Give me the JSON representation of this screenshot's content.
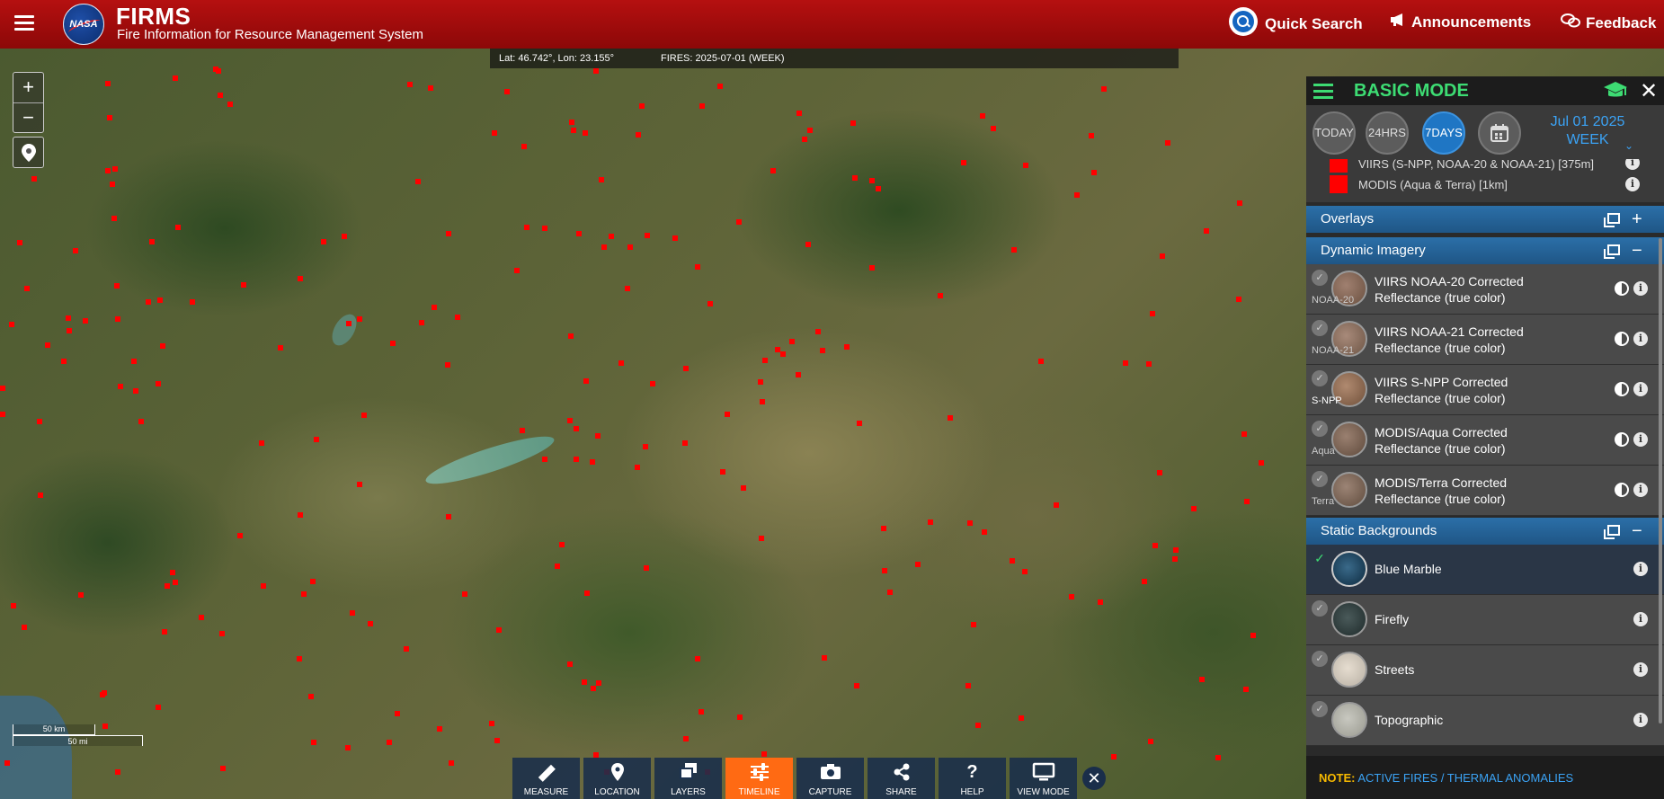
{
  "header": {
    "logo_text": "NASA",
    "title": "FIRMS",
    "subtitle": "Fire Information for Resource Management System",
    "quick_search": "Quick Search",
    "announcements": "Announcements",
    "feedback": "Feedback"
  },
  "map": {
    "coords": "Lat: 46.742°, Lon: 23.155°",
    "fires_label": "FIRES: 2025-07-01 (WEEK)",
    "zoom_in": "+",
    "zoom_out": "−",
    "scale_km": "50 km",
    "scale_mi": "50 mi",
    "fire_color": "#ff0000"
  },
  "toolbar": {
    "measure": "MEASURE",
    "location": "LOCATION",
    "layers": "LAYERS",
    "timeline": "TIMELINE",
    "capture": "CAPTURE",
    "share": "SHARE",
    "help": "HELP",
    "view_mode": "VIEW MODE",
    "active": "TIMELINE",
    "active_color": "#ff6a13"
  },
  "panel": {
    "mode_title": "BASIC MODE",
    "today": "TODAY",
    "hrs24": "24HRS",
    "days7": "7DAYS",
    "date_line1": "Jul 01 2025",
    "date_line2": "WEEK",
    "fire_layers": [
      {
        "label": "VIIRS (S-NPP, NOAA-20 & NOAA-21) [375m]"
      },
      {
        "label": "MODIS (Aqua & Terra) [1km]"
      }
    ],
    "overlays_title": "Overlays",
    "dynamic_title": "Dynamic Imagery",
    "dynamic_items": [
      {
        "line1": "VIIRS NOAA-20 Corrected",
        "line2": "Reflectance (true color)",
        "thumb": "NOAA-20"
      },
      {
        "line1": "VIIRS NOAA-21 Corrected",
        "line2": "Reflectance (true color)",
        "thumb": "NOAA-21"
      },
      {
        "line1": "VIIRS S-NPP Corrected",
        "line2": "Reflectance (true color)",
        "thumb": "S-NPP"
      },
      {
        "line1": "MODIS/Aqua Corrected",
        "line2": "Reflectance (true color)",
        "thumb": "Aqua"
      },
      {
        "line1": "MODIS/Terra Corrected",
        "line2": "Reflectance (true color)",
        "thumb": "Terra"
      }
    ],
    "static_title": "Static Backgrounds",
    "static_items": [
      {
        "label": "Blue Marble",
        "selected": true
      },
      {
        "label": "Firefly"
      },
      {
        "label": "Streets"
      },
      {
        "label": "Topographic"
      }
    ],
    "note_label": "NOTE:",
    "note_text": "ACTIVE FIRES / THERMAL ANOMALIES"
  }
}
